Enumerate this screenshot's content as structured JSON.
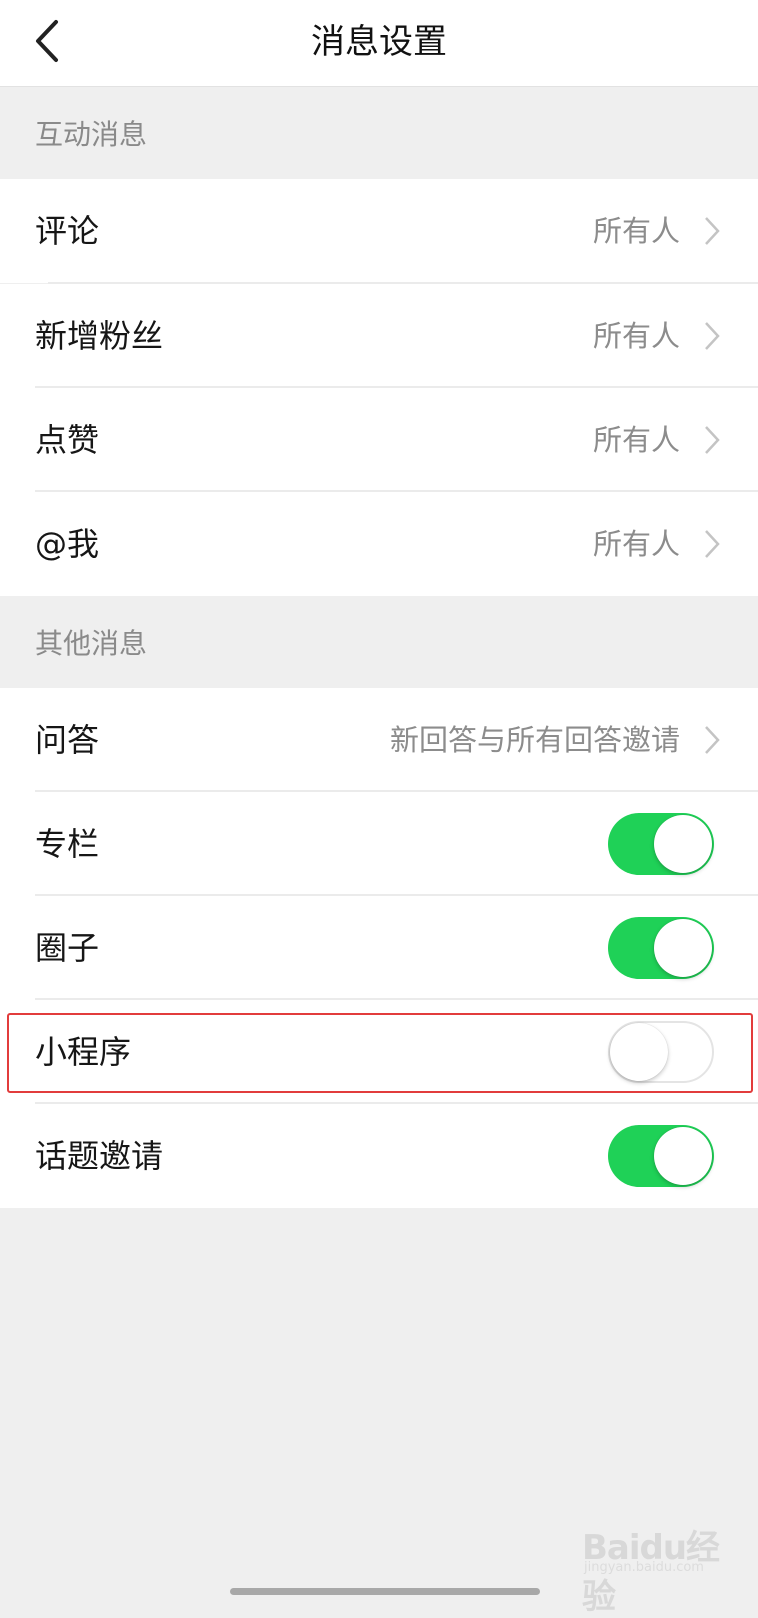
{
  "nav": {
    "title": "消息设置",
    "back_icon": "chevron-left-icon"
  },
  "sections": {
    "interactive": {
      "title": "互动消息",
      "items": [
        {
          "label": "评论",
          "value": "所有人"
        },
        {
          "label": "新增粉丝",
          "value": "所有人"
        },
        {
          "label": "点赞",
          "value": "所有人"
        },
        {
          "label": "@我",
          "value": "所有人"
        }
      ]
    },
    "other": {
      "title": "其他消息",
      "items": [
        {
          "label": "问答",
          "value": "新回答与所有回答邀请"
        },
        {
          "label": "专栏",
          "toggle": true
        },
        {
          "label": "圈子",
          "toggle": true
        },
        {
          "label": "小程序",
          "toggle": false
        },
        {
          "label": "话题邀请",
          "toggle": true
        }
      ]
    }
  },
  "watermark": {
    "logo": "Baidu经验",
    "sub": "jingyan.baidu.com"
  },
  "colors": {
    "toggle_on": "#1fd157",
    "highlight": "#e23c3c",
    "background": "#efefef"
  }
}
